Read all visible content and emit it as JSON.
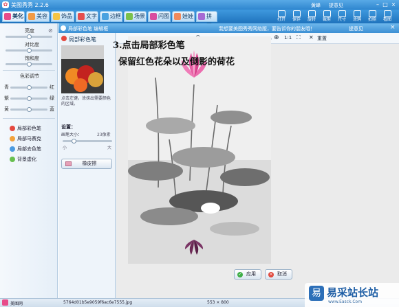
{
  "app": {
    "title": "美图秀秀 2.2.6",
    "user": "黄峰",
    "login": "提意见"
  },
  "tabs": [
    {
      "label": "美化",
      "active": true,
      "color": "#e84c8a"
    },
    {
      "label": "美容",
      "active": false,
      "color": "#f29b45"
    },
    {
      "label": "饰品",
      "active": false,
      "color": "#f5c445"
    },
    {
      "label": "文字",
      "active": false,
      "color": "#e54e4e"
    },
    {
      "label": "边框",
      "active": false,
      "color": "#4aa2e0"
    },
    {
      "label": "场景",
      "active": false,
      "color": "#7bc14b"
    },
    {
      "label": "闪图",
      "active": false,
      "color": "#d94d9f"
    },
    {
      "label": "娃娃",
      "active": false,
      "color": "#f08a5d"
    },
    {
      "label": "拼图",
      "active": false,
      "color": "#a66ad3"
    }
  ],
  "tools": [
    "打开",
    "保存",
    "旋转",
    "裁剪",
    "尺寸",
    "涂鸦",
    "拍照",
    "看图"
  ],
  "left": {
    "sliders": [
      {
        "label": "亮度",
        "value": 0.5
      },
      {
        "label": "对比度",
        "value": 0.5
      },
      {
        "label": "饱和度",
        "value": 0.5
      }
    ],
    "color_title": "色彩调节",
    "color_sliders": [
      {
        "l": "青",
        "r": "红",
        "value": 0.5
      },
      {
        "l": "紫",
        "r": "绿",
        "value": 0.5
      },
      {
        "l": "黄",
        "r": "蓝",
        "value": 0.5
      }
    ],
    "menu": [
      {
        "label": "局部彩色笔",
        "color": "#e5483e"
      },
      {
        "label": "局部马赛克",
        "color": "#f2a23b"
      },
      {
        "label": "局部去色笔",
        "color": "#4c9be0"
      },
      {
        "label": "背景虚化",
        "color": "#67bf4f"
      }
    ]
  },
  "editor": {
    "title": "局部彩色笔 编辑框",
    "notice": "我想要美图秀秀网络版，要告诉你的朋友哦！",
    "help": "提意见",
    "panel_title": "局部彩色笔",
    "desc": "点击左键，涂抹出需要颜色的区域。",
    "settings": "设置：",
    "brush_label": "画笔大小：",
    "brush_value": "23像素",
    "brush_level": 0.2,
    "small": "小",
    "big": "大",
    "eraser": "橡皮擦",
    "zoom_label": "1:1",
    "reset": "重置",
    "apply": "应用",
    "cancel": "取消"
  },
  "annotation": {
    "line1": "3.点击局部彩色笔",
    "line2": "保留红色花朵以及倒影的荷花"
  },
  "status": {
    "file": "5764d01b5e9059f6ac6e7555.jpg",
    "size": "553 × 800",
    "bottom_left": "美图网"
  },
  "watermark": {
    "text": "易采站长站",
    "sub": "www.Easck.Com"
  }
}
